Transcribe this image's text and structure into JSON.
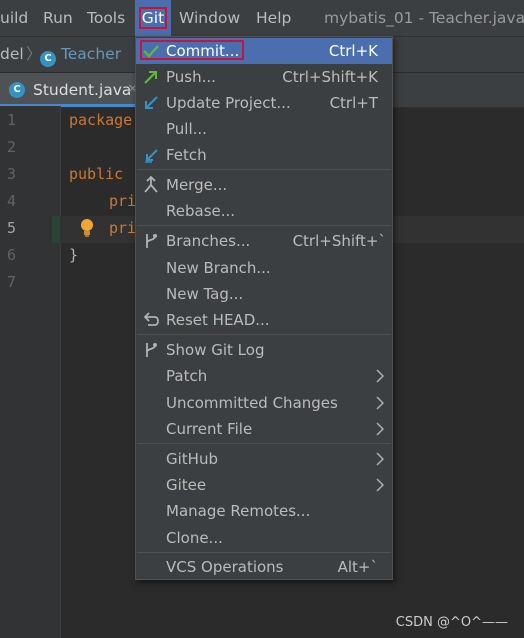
{
  "menubar": {
    "items": [
      {
        "label": "uild"
      },
      {
        "label": "Run"
      },
      {
        "label": "Tools"
      },
      {
        "label": "Git"
      },
      {
        "label": "Window"
      },
      {
        "label": "Help"
      }
    ],
    "title": "mybatis_01 - Teacher.java"
  },
  "breadcrumbs": {
    "first": "del",
    "second": "Teacher"
  },
  "tabs": {
    "active": "Student.java"
  },
  "editor": {
    "line_numbers": [
      "1",
      "2",
      "3",
      "4",
      "5",
      "6",
      "7"
    ],
    "lines": {
      "l1": "package",
      "l3": "public",
      "l4": "pri",
      "l5": "pri",
      "l6": "}"
    }
  },
  "git_menu": {
    "items": [
      {
        "label": "Commit...",
        "shortcut": "Ctrl+K",
        "icon": "checkmark-icon"
      },
      {
        "label": "Push...",
        "shortcut": "Ctrl+Shift+K",
        "icon": "push-arrow-icon"
      },
      {
        "label": "Update Project...",
        "shortcut": "Ctrl+T",
        "icon": "update-arrow-icon"
      },
      {
        "label": "Pull...",
        "shortcut": ""
      },
      {
        "label": "Fetch",
        "shortcut": "",
        "icon": "fetch-arrow-icon"
      },
      {
        "label": "Merge...",
        "shortcut": "",
        "icon": "merge-icon"
      },
      {
        "label": "Rebase...",
        "shortcut": ""
      },
      {
        "label": "Branches...",
        "shortcut": "Ctrl+Shift+`",
        "icon": "branch-icon"
      },
      {
        "label": "New Branch...",
        "shortcut": ""
      },
      {
        "label": "New Tag...",
        "shortcut": ""
      },
      {
        "label": "Reset HEAD...",
        "shortcut": "",
        "icon": "reset-icon"
      },
      {
        "label": "Show Git Log",
        "shortcut": "",
        "icon": "git-log-icon"
      },
      {
        "label": "Patch",
        "submenu": true
      },
      {
        "label": "Uncommitted Changes",
        "submenu": true
      },
      {
        "label": "Current File",
        "submenu": true
      },
      {
        "label": "GitHub",
        "submenu": true
      },
      {
        "label": "Gitee",
        "submenu": true
      },
      {
        "label": "Manage Remotes..."
      },
      {
        "label": "Clone..."
      },
      {
        "label": "VCS Operations",
        "shortcut": "Alt+`"
      }
    ]
  },
  "watermark": "CSDN @^O^——",
  "colors": {
    "accent": "#4b6eaf",
    "highlight_border": "#c3163a",
    "keyword": "#cc7832",
    "background": "#2b2b2b",
    "menu_bg": "#3c3f41"
  }
}
